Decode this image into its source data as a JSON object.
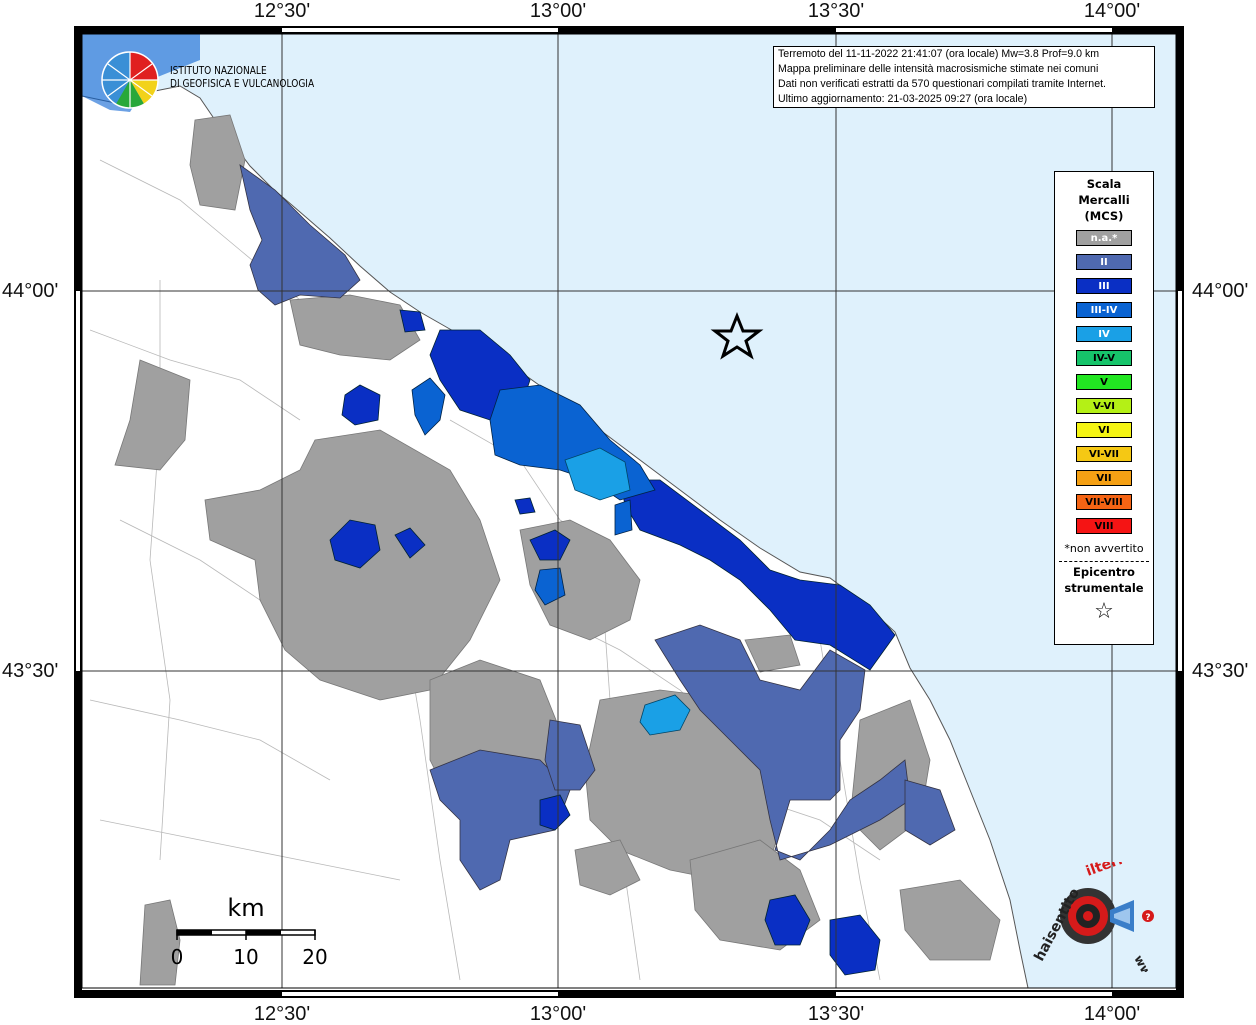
{
  "axes": {
    "lon_labels": [
      "12°30'",
      "13°00'",
      "13°30'",
      "14°00'"
    ],
    "lat_labels": [
      "44°00'",
      "43°30'"
    ]
  },
  "info": {
    "line1": "Terremoto del 11-11-2022 21:41:07 (ora locale) Mw=3.8 Prof=9.0 km",
    "line2": "Mappa preliminare delle intensità macrosismiche stimate nei comuni",
    "line3": "Dati non verificati estratti da 570 questionari compilati tramite Internet.",
    "line4": "Ultimo aggiornamento: 21-03-2025 09:27 (ora locale)"
  },
  "logo": {
    "line1": "ISTITUTO NAZIONALE",
    "line2": "DI GEOFISICA E VULCANOLOGIA"
  },
  "legend": {
    "title_1": "Scala",
    "title_2": "Mercalli",
    "title_3": "(MCS)",
    "items": [
      {
        "label": "n.a.*",
        "color": "#a0a0a0",
        "text_color": "#ffffff"
      },
      {
        "label": "II",
        "color": "#4f69b0",
        "text_color": "#ffffff"
      },
      {
        "label": "III",
        "color": "#0a2fc4",
        "text_color": "#ffffff"
      },
      {
        "label": "III-IV",
        "color": "#0a63d2",
        "text_color": "#ffffff"
      },
      {
        "label": "IV",
        "color": "#1aa0e6",
        "text_color": "#ffffff"
      },
      {
        "label": "IV-V",
        "color": "#16c46a",
        "text_color": "#000000"
      },
      {
        "label": "V",
        "color": "#22e622",
        "text_color": "#000000"
      },
      {
        "label": "V-VI",
        "color": "#b4f016",
        "text_color": "#000000"
      },
      {
        "label": "VI",
        "color": "#f5f514",
        "text_color": "#000000"
      },
      {
        "label": "VI-VII",
        "color": "#f5c814",
        "text_color": "#000000"
      },
      {
        "label": "VII",
        "color": "#f5a014",
        "text_color": "#000000"
      },
      {
        "label": "VII-VIII",
        "color": "#f56414",
        "text_color": "#000000"
      },
      {
        "label": "VIII",
        "color": "#f51414",
        "text_color": "#000000"
      }
    ],
    "note": "*non avvertito",
    "epicenter_1": "Epicentro",
    "epicenter_2": "strumentale",
    "star": "☆"
  },
  "scalebar": {
    "unit": "km",
    "ticks": [
      "0",
      "10",
      "20"
    ]
  },
  "hsi_logo": {
    "text_dark": "haisentito",
    "text_red": "ilterremoto.it",
    "prefix": "www."
  },
  "colors": {
    "sea": "#dff1fc",
    "land": "#ffffff",
    "not_felt": "#a0a0a0",
    "mcs_II": "#4f69b0",
    "mcs_III": "#0a2fc4",
    "mcs_III_IV": "#0a63d2",
    "mcs_IV": "#1aa0e6"
  }
}
